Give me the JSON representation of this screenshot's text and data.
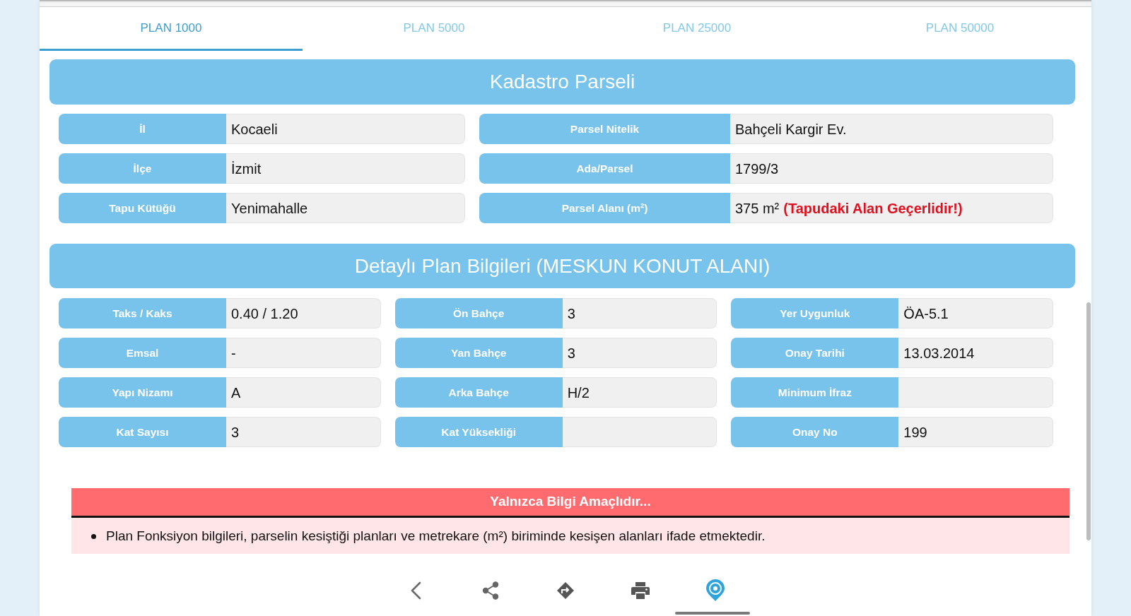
{
  "tabs": [
    {
      "label": "PLAN 1000",
      "selected": true
    },
    {
      "label": "PLAN 5000",
      "selected": false
    },
    {
      "label": "PLAN 25000",
      "selected": false
    },
    {
      "label": "PLAN 50000",
      "selected": false
    }
  ],
  "parcel_section": {
    "title": "Kadastro Parseli",
    "left_fields": [
      {
        "label": "İl",
        "value": "Kocaeli"
      },
      {
        "label": "İlçe",
        "value": "İzmit"
      },
      {
        "label": "Tapu Kütüğü",
        "value": "Yenimahalle"
      }
    ],
    "right_fields": [
      {
        "label": "Parsel Nitelik",
        "value": "Bahçeli Kargir Ev."
      },
      {
        "label": "Ada/Parsel",
        "value": "1799/3"
      },
      {
        "label": "Parsel Alanı (m²)",
        "value": "375 m²",
        "note": "(Tapudaki Alan Geçerlidir!)"
      }
    ]
  },
  "plan_section": {
    "title": "Detaylı Plan Bilgileri (MESKUN KONUT ALANI)",
    "columns": [
      [
        {
          "label": "Taks / Kaks",
          "value": "0.40 / 1.20"
        },
        {
          "label": "Emsal",
          "value": "-"
        },
        {
          "label": "Yapı Nizamı",
          "value": "A"
        },
        {
          "label": "Kat Sayısı",
          "value": "3"
        }
      ],
      [
        {
          "label": "Ön Bahçe",
          "value": "3"
        },
        {
          "label": "Yan Bahçe",
          "value": "3"
        },
        {
          "label": "Arka Bahçe",
          "value": "H/2"
        },
        {
          "label": "Kat Yüksekliği"
        }
      ],
      [
        {
          "label": "Yer Uygunluk",
          "value": "ÖA-5.1"
        },
        {
          "label": "Onay Tarihi",
          "value": "13.03.2014"
        },
        {
          "label": "Minimum İfraz"
        },
        {
          "label": "Onay No",
          "value": "199"
        }
      ]
    ]
  },
  "notice": {
    "title": "Yalnızca Bilgi Amaçlıdır...",
    "items": [
      "Plan Fonksiyon bilgileri, parselin kesiştiği planları ve metrekare (m²) biriminde kesişen alanları ifade etmektedir."
    ]
  }
}
